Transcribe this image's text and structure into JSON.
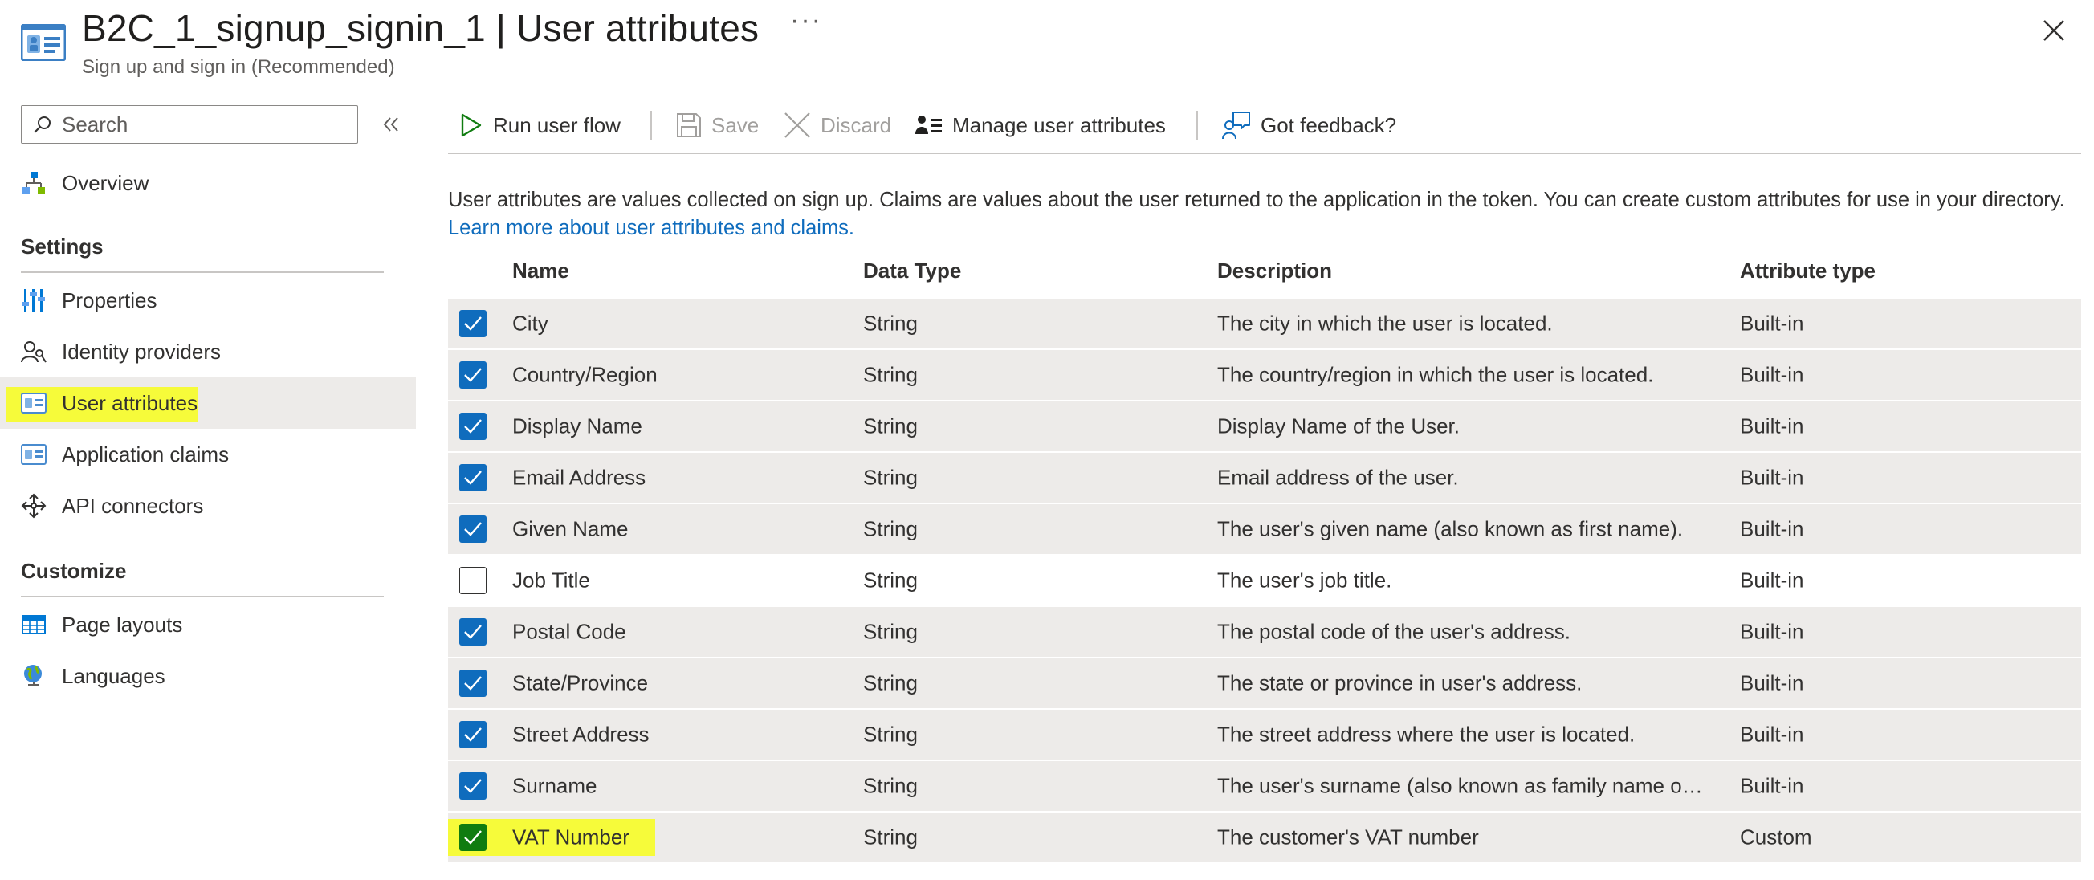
{
  "header": {
    "title": "B2C_1_signup_signin_1",
    "title_sep": " | ",
    "section": "User attributes",
    "more": "···",
    "subtitle": "Sign up and sign in (Recommended)"
  },
  "sidebar": {
    "search_placeholder": "Search",
    "overview": "Overview",
    "settings_head": "Settings",
    "settings_items": [
      {
        "label": "Properties",
        "icon": "properties-icon"
      },
      {
        "label": "Identity providers",
        "icon": "identity-providers-icon"
      },
      {
        "label": "User attributes",
        "icon": "user-attributes-icon",
        "selected": true
      },
      {
        "label": "Application claims",
        "icon": "application-claims-icon"
      },
      {
        "label": "API connectors",
        "icon": "api-connectors-icon"
      }
    ],
    "customize_head": "Customize",
    "customize_items": [
      {
        "label": "Page layouts",
        "icon": "page-layouts-icon"
      },
      {
        "label": "Languages",
        "icon": "languages-icon"
      }
    ]
  },
  "toolbar": {
    "run": "Run user flow",
    "save": "Save",
    "discard": "Discard",
    "manage": "Manage user attributes",
    "feedback": "Got feedback?"
  },
  "content": {
    "description": "User attributes are values collected on sign up. Claims are values about the user returned to the application in the token. You can create custom attributes for use in your directory.",
    "learn_more": "Learn more about user attributes and claims."
  },
  "table": {
    "columns": [
      "Name",
      "Data Type",
      "Description",
      "Attribute type"
    ],
    "rows": [
      {
        "name": "City",
        "type": "String",
        "description": "The city in which the user is located.",
        "attr": "Built-in",
        "checked": true
      },
      {
        "name": "Country/Region",
        "type": "String",
        "description": "The country/region in which the user is located.",
        "attr": "Built-in",
        "checked": true
      },
      {
        "name": "Display Name",
        "type": "String",
        "description": "Display Name of the User.",
        "attr": "Built-in",
        "checked": true
      },
      {
        "name": "Email Address",
        "type": "String",
        "description": "Email address of the user.",
        "attr": "Built-in",
        "checked": true
      },
      {
        "name": "Given Name",
        "type": "String",
        "description": "The user's given name (also known as first name).",
        "attr": "Built-in",
        "checked": true
      },
      {
        "name": "Job Title",
        "type": "String",
        "description": "The user's job title.",
        "attr": "Built-in",
        "checked": false
      },
      {
        "name": "Postal Code",
        "type": "String",
        "description": "The postal code of the user's address.",
        "attr": "Built-in",
        "checked": true
      },
      {
        "name": "State/Province",
        "type": "String",
        "description": "The state or province in user's address.",
        "attr": "Built-in",
        "checked": true
      },
      {
        "name": "Street Address",
        "type": "String",
        "description": "The street address where the user is located.",
        "attr": "Built-in",
        "checked": true
      },
      {
        "name": "Surname",
        "type": "String",
        "description": "The user's surname (also known as family name or ...",
        "attr": "Built-in",
        "checked": true
      },
      {
        "name": "VAT Number",
        "type": "String",
        "description": "The customer's VAT number",
        "attr": "Custom",
        "checked": true
      }
    ]
  },
  "colors": {
    "accent": "#0f6cbd",
    "highlight": "#f6fb3a",
    "custom_check": "#107c10",
    "selected_bg": "#edebe9"
  }
}
